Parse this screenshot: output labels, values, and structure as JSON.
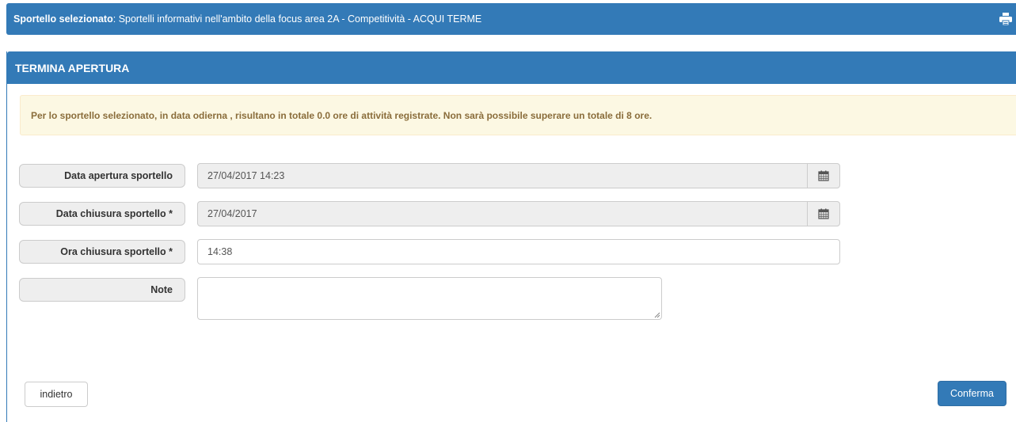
{
  "header": {
    "label": "Sportello selezionato",
    "separator": ":",
    "value": "Sportelli informativi nell'ambito della focus area 2A - Competitività - ACQUI TERME",
    "print_icon": "printer-icon"
  },
  "panel": {
    "title": "TERMINA APERTURA",
    "alert": "Per lo sportello selezionato, in data odierna , risultano in totale 0.0 ore di attività registrate. Non sarà possibile superare un totale di 8 ore."
  },
  "form": {
    "data_apertura": {
      "label": "Data apertura sportello",
      "value": "27/04/2017 14:23",
      "icon": "calendar-icon"
    },
    "data_chiusura": {
      "label": "Data chiusura sportello *",
      "value": "27/04/2017",
      "icon": "calendar-icon"
    },
    "ora_chiusura": {
      "label": "Ora chiusura sportello *",
      "value": "14:38"
    },
    "note": {
      "label": "Note",
      "value": ""
    }
  },
  "actions": {
    "back_label": "indietro",
    "confirm_label": "Conferma"
  },
  "colors": {
    "primary": "#337ab7",
    "alert_bg": "#fcf8e3",
    "alert_text": "#8a6d3b"
  }
}
